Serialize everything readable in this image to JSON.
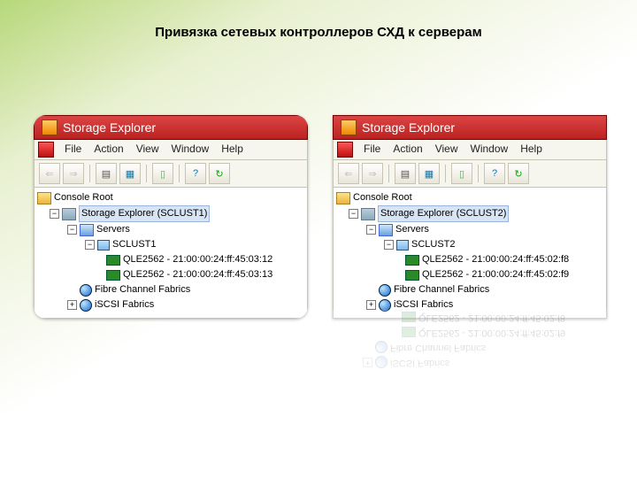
{
  "page_title": "Привязка сетевых контроллеров СХД к серверам",
  "left": {
    "title": "Storage Explorer",
    "menu": [
      "File",
      "Action",
      "View",
      "Window",
      "Help"
    ],
    "root": "Console Root",
    "se_label": "Storage Explorer (SCLUST1)",
    "servers": "Servers",
    "host": "SCLUST1",
    "hba1": "QLE2562 - 21:00:00:24:ff:45:03:12",
    "hba2": "QLE2562 - 21:00:00:24:ff:45:03:13",
    "fc": "Fibre Channel Fabrics",
    "iscsi": "iSCSI Fabrics"
  },
  "right": {
    "title": "Storage Explorer",
    "menu": [
      "File",
      "Action",
      "View",
      "Window",
      "Help"
    ],
    "root": "Console Root",
    "se_label": "Storage Explorer (SCLUST2)",
    "servers": "Servers",
    "host": "SCLUST2",
    "hba1": "QLE2562 - 21:00:00:24:ff:45:02:f8",
    "hba2": "QLE2562 - 21:00:00:24:ff:45:02:f9",
    "fc": "Fibre Channel Fabrics",
    "iscsi": "iSCSI Fabrics"
  }
}
